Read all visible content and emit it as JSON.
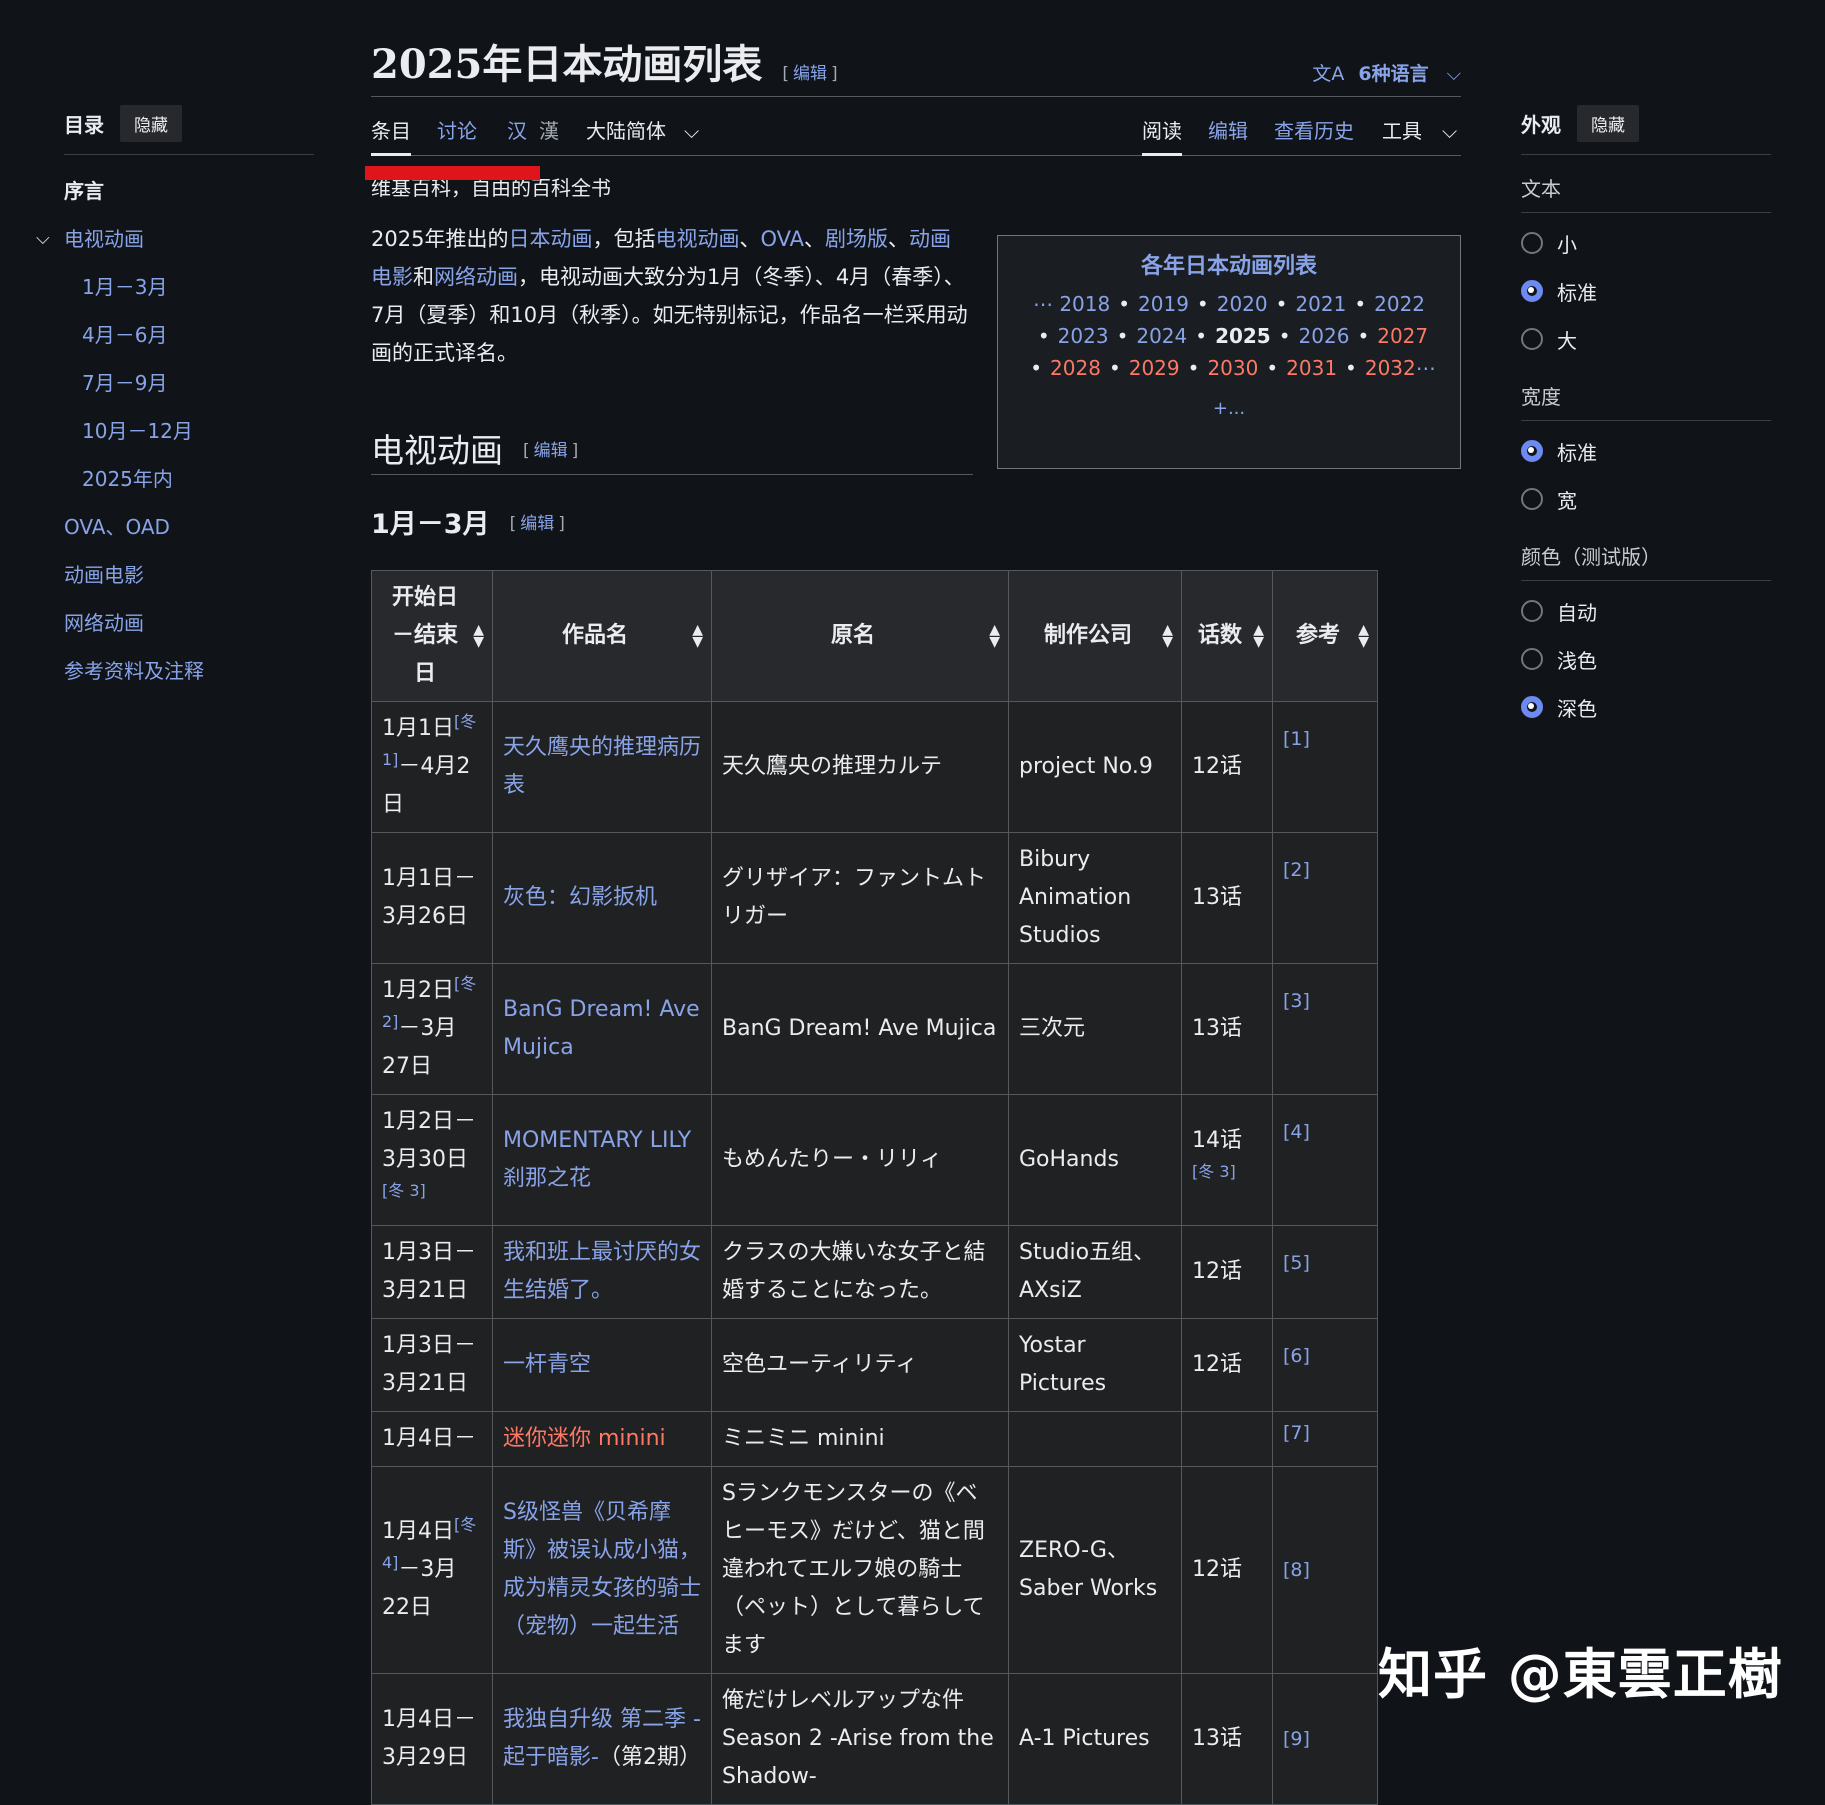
{
  "toc": {
    "title": "目录",
    "hide_label": "隐藏",
    "items": [
      {
        "label": "序言"
      },
      {
        "label": "电视动画"
      },
      {
        "label": "1月－3月"
      },
      {
        "label": "4月－6月"
      },
      {
        "label": "7月－9月"
      },
      {
        "label": "10月－12月"
      },
      {
        "label": "2025年内"
      },
      {
        "label": "OVA、OAD"
      },
      {
        "label": "动画电影"
      },
      {
        "label": "网络动画"
      },
      {
        "label": "参考资料及注释"
      }
    ]
  },
  "header": {
    "page_title": "2025年日本动画列表",
    "edit_label": "编辑",
    "languages_label": "6种语言"
  },
  "tabs": {
    "article": "条目",
    "talk": "讨论",
    "han_simp": "汉",
    "han_trad": "漢",
    "variant": "大陆简体",
    "read": "阅读",
    "edit": "编辑",
    "history": "查看历史",
    "tools": "工具"
  },
  "tagline": "维基百科，自由的百科全书",
  "intro": {
    "t1": "2025年推出的",
    "l1": "日本动画",
    "t2": "，包括",
    "l2": "电视动画",
    "t3": "、",
    "l3": "OVA",
    "t4": "、",
    "l4": "剧场版",
    "t5": "、",
    "l5": "动画电影",
    "t6": "和",
    "l6": "网络动画",
    "t7": "，电视动画大致分为1月（冬季）、4月（春季）、7月（夏季）和10月（秋季）。如无特别标记，作品名一栏采用动画的正式译名。"
  },
  "navbox": {
    "title": "各年日本动画列表",
    "row1": [
      "2018",
      "2019",
      "2020",
      "2021",
      "2022"
    ],
    "row2": [
      "2023",
      "2024",
      "2025",
      "2026",
      "2027"
    ],
    "row3": [
      "2028",
      "2029",
      "2030",
      "2031",
      "2032"
    ],
    "lead_ellipsis": "⋯",
    "trail_ellipsis": "⋯",
    "more": "+..."
  },
  "section_tv": "电视动画",
  "section_jan": "1月－3月",
  "table": {
    "headers": [
      "开始日－结束日",
      "作品名",
      "原名",
      "制作公司",
      "话数",
      "参考"
    ],
    "rows": [
      {
        "date": "1月1日",
        "sup": "[冬 1]",
        "date2": "－4月2日",
        "title": "天久鹰央的推理病历表",
        "orig": "天久鷹央の推理カルテ",
        "studio": "project No.9",
        "eps": "12话",
        "eps_sup": "",
        "ref": "[1]"
      },
      {
        "date": "1月1日－3月26日",
        "sup": "",
        "date2": "",
        "title": "灰色：幻影扳机",
        "orig": "グリザイア：ファントムトリガー",
        "studio": "Bibury Animation Studios",
        "eps": "13话",
        "eps_sup": "",
        "ref": "[2]"
      },
      {
        "date": "1月2日",
        "sup": "[冬 2]",
        "date2": "－3月27日",
        "title": "BanG Dream! Ave Mujica",
        "orig": "BanG Dream! Ave Mujica",
        "studio": "三次元",
        "eps": "13话",
        "eps_sup": "",
        "ref": "[3]"
      },
      {
        "date": "1月2日－3月30日",
        "sup": "[冬 3]",
        "date2": "",
        "title": "MOMENTARY LILY 刹那之花",
        "orig": "もめんたりー・リリィ",
        "studio": "GoHands",
        "eps": "14话",
        "eps_sup": "[冬 3]",
        "ref": "[4]"
      },
      {
        "date": "1月3日－3月21日",
        "sup": "",
        "date2": "",
        "title": "我和班上最讨厌的女生结婚了。",
        "orig": "クラスの大嫌いな女子と結婚することになった。",
        "studio": "Studio五组、AXsiZ",
        "eps": "12话",
        "eps_sup": "",
        "ref": "[5]"
      },
      {
        "date": "1月3日－3月21日",
        "sup": "",
        "date2": "",
        "title": "一杆青空",
        "orig": "空色ユーティリティ",
        "studio": "Yostar Pictures",
        "eps": "12话",
        "eps_sup": "",
        "ref": "[6]"
      },
      {
        "date": "1月4日－",
        "sup": "",
        "date2": "",
        "title": "迷你迷你 minini",
        "orig": "ミニミニ minini",
        "studio": "",
        "eps": "",
        "eps_sup": "",
        "ref": "[7]"
      },
      {
        "date": "1月4日",
        "sup": "[冬 4]",
        "date2": "－3月22日",
        "title": "S级怪兽《贝希摩斯》被误认成小猫，成为精灵女孩的骑士（宠物）一起生活",
        "orig": "Sランクモンスターの《ベヒーモス》だけど、猫と間違われてエルフ娘の騎士（ペット）として暮らしてます",
        "studio": "ZERO-G、Saber Works",
        "eps": "12话",
        "eps_sup": "",
        "ref": "[8]"
      },
      {
        "date": "1月4日－3月29日",
        "sup": "",
        "date2": "",
        "title": "我独自升级 第二季 -起于暗影-",
        "title_suffix": "（第2期）",
        "orig": "俺だけレベルアップな件 Season 2 -Arise from the Shadow-",
        "studio": "A-1 Pictures",
        "eps": "13话",
        "eps_sup": "",
        "ref": "[9]"
      }
    ]
  },
  "appearance": {
    "title": "外观",
    "hide_label": "隐藏",
    "text_section": "文本",
    "text_options": [
      "小",
      "标准",
      "大"
    ],
    "width_section": "宽度",
    "width_options": [
      "标准",
      "宽"
    ],
    "color_section": "颜色（测试版）",
    "color_options": [
      "自动",
      "浅色",
      "深色"
    ]
  },
  "watermark": "知乎 @東雲正樹",
  "colors": {
    "background": "#101418",
    "link": "#88a3e8",
    "redlink": "#fd7865",
    "accent": "#6d8af0"
  }
}
